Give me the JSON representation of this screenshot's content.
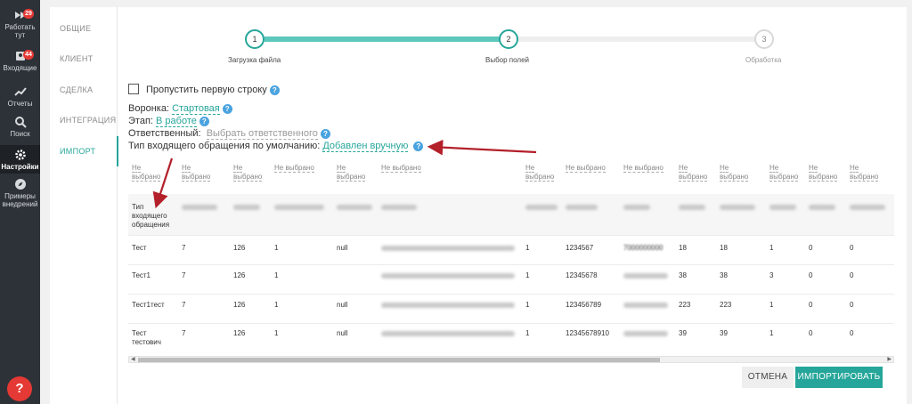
{
  "sidebar": {
    "items": [
      {
        "label": "Работать тут",
        "badge": "29",
        "icon": "fast-forward-icon"
      },
      {
        "label": "Входящие",
        "badge": "44",
        "icon": "inbox-icon"
      },
      {
        "label": "Отчеты",
        "icon": "trend-icon"
      },
      {
        "label": "Поиск",
        "icon": "search-icon"
      },
      {
        "label": "Настройки",
        "icon": "gear-icon",
        "active": true
      },
      {
        "label": "Примеры внедрений",
        "icon": "compass-icon"
      }
    ],
    "help": "?"
  },
  "tabs": [
    "ОБЩИЕ",
    "КЛИЕНТ",
    "СДЕЛКА",
    "ИНТЕГРАЦИЯ",
    "ИМПОРТ"
  ],
  "stepper": {
    "steps": [
      {
        "num": "1",
        "label": "Загрузка файла"
      },
      {
        "num": "2",
        "label": "Выбор полей"
      },
      {
        "num": "3",
        "label": "Обработка"
      }
    ],
    "accent": "#26a69a"
  },
  "options": {
    "skip_first_row": "Пропустить первую строку",
    "funnel_label": "Воронка:",
    "funnel_value": "Стартовая",
    "stage_label": "Этап:",
    "stage_value": "В работе",
    "responsible_label": "Ответственный:",
    "responsible_value": "Выбрать ответственного",
    "incoming_label": "Тип входящего обращения по умолчанию:",
    "incoming_value": "Добавлен вручную"
  },
  "table": {
    "headers": [
      "Не выбрано",
      "Не выбрано",
      "Не выбрано",
      "Не выбрано",
      "Не выбрано",
      "Не выбрано",
      "Не выбрано",
      "Не выбрано",
      "Не выбрано",
      "Не выбрано",
      "Не выбрано",
      "Не выбрано",
      "Не выбрано",
      "Не выбрано",
      "Не выбрано"
    ],
    "first_row_label": "Тип входящего обращения",
    "rows": [
      [
        "Тест",
        "7",
        "126",
        "1",
        "null",
        "",
        "1",
        "1234567",
        "7000000000",
        "18",
        "18",
        "1",
        "0",
        "0"
      ],
      [
        "Тест1",
        "7",
        "126",
        "1",
        "null",
        "",
        "1",
        "12345678",
        "",
        "38",
        "38",
        "3",
        "0",
        "0"
      ],
      [
        "Тест1тест",
        "7",
        "126",
        "1",
        "null",
        "",
        "1",
        "123456789",
        "",
        "223",
        "223",
        "1",
        "0",
        "0"
      ],
      [
        "Тест тестович",
        "7",
        "126",
        "1",
        "null",
        "",
        "1",
        "12345678910",
        "",
        "39",
        "39",
        "1",
        "0",
        "0"
      ]
    ]
  },
  "buttons": {
    "cancel": "ОТМЕНА",
    "import": "ИМПОРТИРОВАТЬ"
  }
}
